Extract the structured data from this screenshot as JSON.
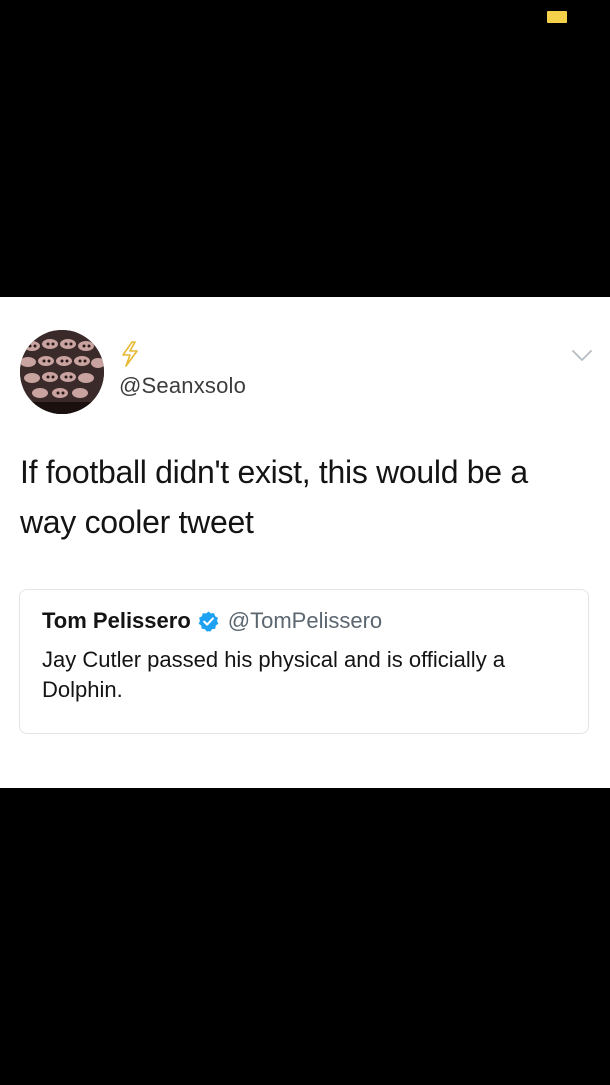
{
  "status_bar": {
    "battery_icon": "battery-icon",
    "battery_color": "#f5d04a"
  },
  "tweet": {
    "avatar_icon": "avatar",
    "name_icon": "lightning-bolt-icon",
    "handle": "@Seanxsolo",
    "menu_icon": "chevron-down-icon",
    "text": "If football didn't exist, this would be a way cooler tweet"
  },
  "quoted_tweet": {
    "name": "Tom Pelissero",
    "verified_icon": "verified-badge-icon",
    "verified_color": "#1da1f2",
    "handle": "@TomPelissero",
    "text": "Jay Cutler passed his physical and is officially a Dolphin."
  }
}
